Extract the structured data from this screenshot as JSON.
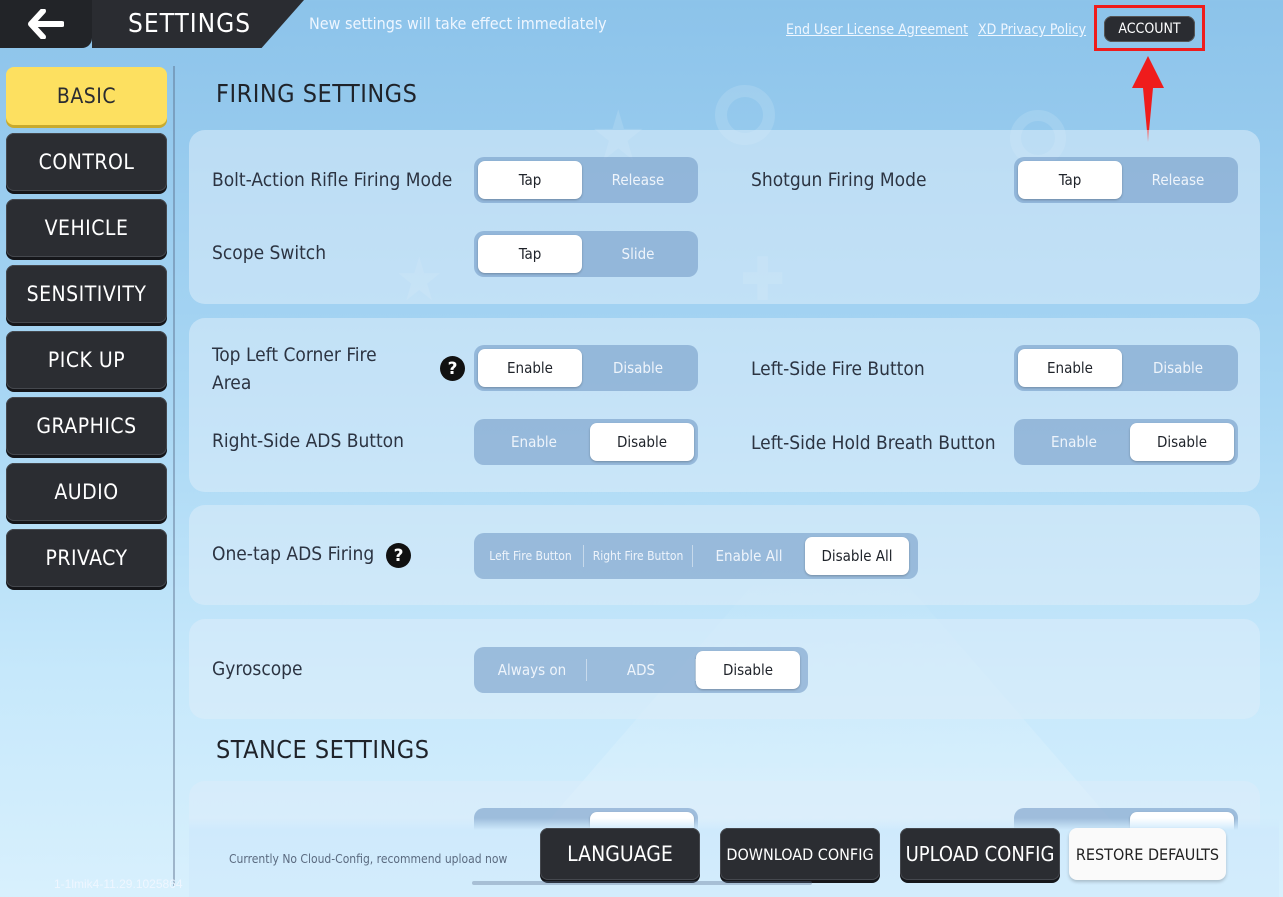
{
  "header": {
    "title": "SETTINGS",
    "notice": "New settings will take effect immediately",
    "eula_link": "End User License Agreement",
    "privacy_link": "XD Privacy Policy",
    "account_button": "ACCOUNT"
  },
  "sidebar": {
    "items": [
      {
        "label": "BASIC",
        "active": true
      },
      {
        "label": "CONTROL"
      },
      {
        "label": "VEHICLE"
      },
      {
        "label": "SENSITIVITY"
      },
      {
        "label": "PICK UP"
      },
      {
        "label": "GRAPHICS"
      },
      {
        "label": "AUDIO"
      },
      {
        "label": "PRIVACY"
      }
    ]
  },
  "firing": {
    "title": "FIRING SETTINGS",
    "bolt_action": {
      "label": "Bolt-Action Rifle Firing Mode",
      "options": [
        "Tap",
        "Release"
      ],
      "selected": "Tap"
    },
    "shotgun": {
      "label": "Shotgun Firing Mode",
      "options": [
        "Tap",
        "Release"
      ],
      "selected": "Tap"
    },
    "scope_switch": {
      "label": "Scope Switch",
      "options": [
        "Tap",
        "Slide"
      ],
      "selected": "Tap"
    },
    "top_left_fire": {
      "label_line1": "Top Left Corner Fire",
      "label_line2": "Area",
      "options": [
        "Enable",
        "Disable"
      ],
      "selected": "Enable"
    },
    "left_fire_button": {
      "label": "Left-Side Fire Button",
      "options": [
        "Enable",
        "Disable"
      ],
      "selected": "Enable"
    },
    "right_ads": {
      "label": "Right-Side ADS Button",
      "options": [
        "Enable",
        "Disable"
      ],
      "selected": "Disable"
    },
    "left_hold_breath": {
      "label": "Left-Side Hold Breath Button",
      "options": [
        "Enable",
        "Disable"
      ],
      "selected": "Disable"
    },
    "one_tap_ads": {
      "label": "One-tap ADS Firing",
      "options": [
        "Left Fire Button",
        "Right Fire Button",
        "Enable All",
        "Disable All"
      ],
      "selected": "Disable All"
    },
    "gyroscope": {
      "label": "Gyroscope",
      "options": [
        "Always on",
        "ADS",
        "Disable"
      ],
      "selected": "Disable"
    }
  },
  "stance": {
    "title": "STANCE SETTINGS"
  },
  "footer": {
    "cloud_note": "Currently No Cloud-Config, recommend upload now",
    "version": "1-1lmik4-11.29.1025864",
    "language": "LANGUAGE",
    "download": "DOWNLOAD CONFIG",
    "upload": "UPLOAD CONFIG",
    "restore": "RESTORE DEFAULTS"
  },
  "colors": {
    "annotation_red": "#ef1c1c",
    "active_tab": "#fde060",
    "dark_button": "#2b2d32"
  }
}
